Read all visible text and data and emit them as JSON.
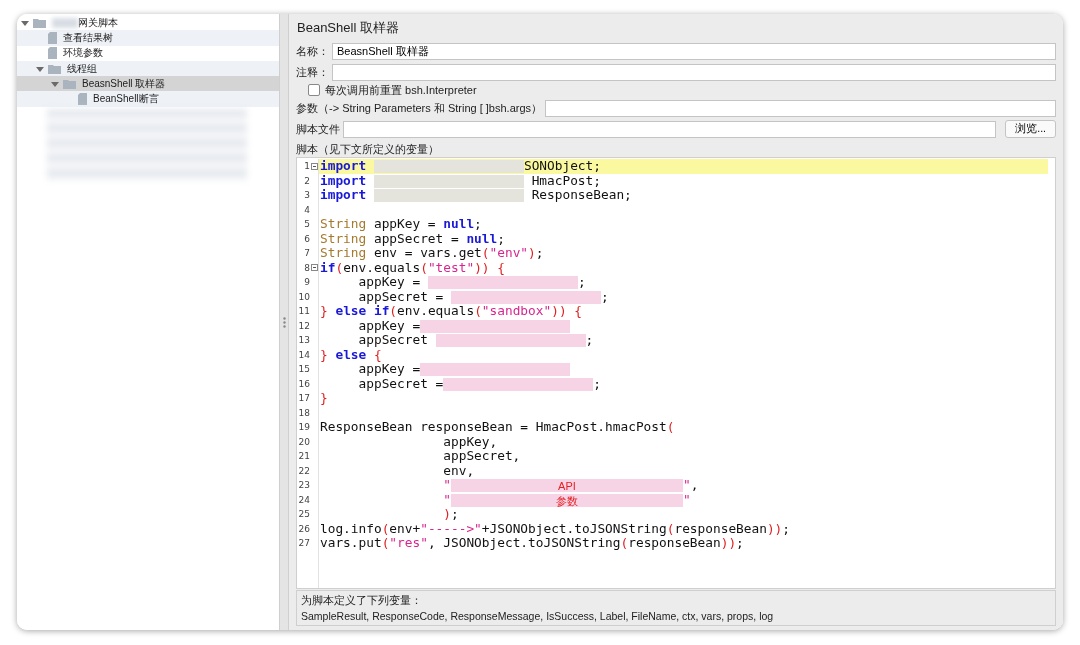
{
  "tree": [
    {
      "label": "网关脚本",
      "blurred_prefix": true,
      "kind": "folder",
      "expanded": true,
      "selected": false,
      "children": [
        {
          "label": "查看结果树",
          "kind": "file",
          "selected": false
        },
        {
          "label": "环境参数",
          "kind": "file",
          "selected": false
        },
        {
          "label": "线程组",
          "kind": "folder",
          "expanded": true,
          "selected": false,
          "children": [
            {
              "label": "BeasnShell 取样器",
              "kind": "folder",
              "expanded": true,
              "selected": true,
              "children": [
                {
                  "label": "BeanShell断言",
                  "kind": "file",
                  "selected": false
                }
              ]
            }
          ]
        }
      ]
    }
  ],
  "panel": {
    "title": "BeanShell 取样器",
    "name_label": "名称：",
    "name_value": "BeasnShell 取样器",
    "comment_label": "注释：",
    "reset_checkbox": {
      "label": "每次调用前重置 bsh.Interpreter",
      "checked": false
    },
    "params_label": "参数（-> String Parameters 和 String [ ]bsh.args）",
    "file_label": "脚本文件",
    "browse_button": "浏览...",
    "script_label": "脚本（见下文所定义的变量）",
    "code_lines": [
      {
        "number": "1",
        "current": true,
        "foldable": true,
        "segments": [
          {
            "kind": "kw",
            "text": "import "
          },
          {
            "kind": "blur",
            "color": "#e4e4dc"
          },
          {
            "kind": "plain",
            "text": "SONObject;"
          }
        ]
      },
      {
        "number": "2",
        "current": false,
        "foldable": false,
        "segments": [
          {
            "kind": "kw",
            "text": "import "
          },
          {
            "kind": "blur",
            "color": "#e4e4dc"
          },
          {
            "kind": "plain",
            "text": " HmacPost;"
          }
        ]
      },
      {
        "number": "3",
        "current": false,
        "foldable": false,
        "segments": [
          {
            "kind": "kw",
            "text": "import "
          },
          {
            "kind": "blur",
            "color": "#e4e4dc"
          },
          {
            "kind": "plain",
            "text": " ResponseBean;"
          }
        ]
      },
      {
        "number": "4",
        "current": false,
        "foldable": false
      },
      {
        "number": "5",
        "current": false,
        "foldable": false,
        "segments": [
          {
            "kind": "type",
            "text": "String"
          },
          {
            "kind": "plain",
            "text": " appKey = "
          },
          {
            "kind": "kw",
            "text": "null"
          },
          {
            "kind": "plain",
            "text": ";"
          }
        ]
      },
      {
        "number": "6",
        "current": false,
        "foldable": false,
        "segments": [
          {
            "kind": "type",
            "text": "String"
          },
          {
            "kind": "plain",
            "text": " appSecret = "
          },
          {
            "kind": "kw",
            "text": "null"
          },
          {
            "kind": "plain",
            "text": ";"
          }
        ]
      },
      {
        "number": "7",
        "current": false,
        "foldable": false,
        "segments": [
          {
            "kind": "type",
            "text": "String"
          },
          {
            "kind": "plain",
            "text": " env = vars.get"
          },
          {
            "kind": "paren",
            "text": "("
          },
          {
            "kind": "str",
            "text": "\"env\""
          },
          {
            "kind": "paren",
            "text": ")"
          },
          {
            "kind": "plain",
            "text": ";"
          }
        ]
      },
      {
        "number": "8",
        "current": false,
        "foldable": true,
        "segments": [
          {
            "kind": "kw",
            "text": "if"
          },
          {
            "kind": "paren",
            "text": "("
          },
          {
            "kind": "plain",
            "text": "env.equals"
          },
          {
            "kind": "paren",
            "text": "("
          },
          {
            "kind": "str",
            "text": "\"test\""
          },
          {
            "kind": "paren",
            "text": ")) {"
          }
        ]
      },
      {
        "number": "9",
        "current": false,
        "foldable": false,
        "segments": [
          {
            "kind": "plain",
            "text": "     appKey = "
          },
          {
            "kind": "blur",
            "color": "#f6d4e6"
          },
          {
            "kind": "plain",
            "text": ";"
          }
        ]
      },
      {
        "number": "10",
        "current": false,
        "foldable": false,
        "segments": [
          {
            "kind": "plain",
            "text": "     appSecret = "
          },
          {
            "kind": "blur",
            "color": "#f6d4e6"
          },
          {
            "kind": "plain",
            "text": ";"
          }
        ]
      },
      {
        "number": "11",
        "current": false,
        "foldable": false,
        "segments": [
          {
            "kind": "paren",
            "text": "} "
          },
          {
            "kind": "kw",
            "text": "else if"
          },
          {
            "kind": "paren",
            "text": "("
          },
          {
            "kind": "plain",
            "text": "env.equals"
          },
          {
            "kind": "paren",
            "text": "("
          },
          {
            "kind": "str",
            "text": "\"sandbox\""
          },
          {
            "kind": "paren",
            "text": ")) {"
          }
        ]
      },
      {
        "number": "12",
        "current": false,
        "foldable": false,
        "segments": [
          {
            "kind": "plain",
            "text": "     appKey ="
          },
          {
            "kind": "blur",
            "color": "#f6d4e6"
          }
        ]
      },
      {
        "number": "13",
        "current": false,
        "foldable": false,
        "segments": [
          {
            "kind": "plain",
            "text": "     appSecret "
          },
          {
            "kind": "blur",
            "color": "#f6d4e6"
          },
          {
            "kind": "plain",
            "text": ";"
          }
        ]
      },
      {
        "number": "14",
        "current": false,
        "foldable": false,
        "segments": [
          {
            "kind": "paren",
            "text": "} "
          },
          {
            "kind": "kw",
            "text": "else"
          },
          {
            "kind": "paren",
            "text": " {"
          }
        ]
      },
      {
        "number": "15",
        "current": false,
        "foldable": false,
        "segments": [
          {
            "kind": "plain",
            "text": "     appKey ="
          },
          {
            "kind": "blur",
            "color": "#f6d4e6"
          }
        ]
      },
      {
        "number": "16",
        "current": false,
        "foldable": false,
        "segments": [
          {
            "kind": "plain",
            "text": "     appSecret ="
          },
          {
            "kind": "blur",
            "color": "#f6d4e6"
          },
          {
            "kind": "plain",
            "text": ";"
          }
        ]
      },
      {
        "number": "17",
        "current": false,
        "foldable": false,
        "segments": [
          {
            "kind": "paren",
            "text": "}"
          }
        ]
      },
      {
        "number": "18",
        "current": false,
        "foldable": false
      },
      {
        "number": "19",
        "current": false,
        "foldable": false,
        "segments": [
          {
            "kind": "plain",
            "text": "ResponseBean responseBean = HmacPost.hmacPost"
          },
          {
            "kind": "paren",
            "text": "("
          }
        ]
      },
      {
        "number": "20",
        "current": false,
        "foldable": false,
        "segments": [
          {
            "kind": "plain",
            "text": "                appKey,"
          }
        ]
      },
      {
        "number": "21",
        "current": false,
        "foldable": false,
        "segments": [
          {
            "kind": "plain",
            "text": "                appSecret,"
          }
        ]
      },
      {
        "number": "22",
        "current": false,
        "foldable": false,
        "segments": [
          {
            "kind": "plain",
            "text": "                env,"
          }
        ]
      },
      {
        "number": "23",
        "current": false,
        "foldable": false,
        "segments": [
          {
            "kind": "str",
            "text": "                \""
          },
          {
            "kind": "blur",
            "color": "#f6d4e6",
            "text": "API"
          },
          {
            "kind": "str",
            "text": "\""
          },
          {
            "kind": "plain",
            "text": ","
          }
        ]
      },
      {
        "number": "24",
        "current": false,
        "foldable": false,
        "segments": [
          {
            "kind": "str",
            "text": "                \""
          },
          {
            "kind": "blur",
            "color": "#f6d4e6",
            "text": "参数"
          },
          {
            "kind": "str",
            "text": "\""
          }
        ]
      },
      {
        "number": "25",
        "current": false,
        "foldable": false,
        "segments": [
          {
            "kind": "paren",
            "text": "                )"
          },
          {
            "kind": "plain",
            "text": ";"
          }
        ]
      },
      {
        "number": "26",
        "current": false,
        "foldable": false,
        "segments": [
          {
            "kind": "plain",
            "text": "log.info"
          },
          {
            "kind": "paren",
            "text": "("
          },
          {
            "kind": "plain",
            "text": "env+"
          },
          {
            "kind": "str",
            "text": "\"----->\""
          },
          {
            "kind": "plain",
            "text": "+JSONObject.toJSONString"
          },
          {
            "kind": "paren",
            "text": "("
          },
          {
            "kind": "plain",
            "text": "responseBean"
          },
          {
            "kind": "paren",
            "text": "))"
          },
          {
            "kind": "plain",
            "text": ";"
          }
        ]
      },
      {
        "number": "27",
        "current": false,
        "foldable": false,
        "segments": [
          {
            "kind": "plain",
            "text": "vars.put"
          },
          {
            "kind": "paren",
            "text": "("
          },
          {
            "kind": "str",
            "text": "\"res\""
          },
          {
            "kind": "plain",
            "text": ", JSONObject.toJSONString"
          },
          {
            "kind": "paren",
            "text": "("
          },
          {
            "kind": "plain",
            "text": "responseBean"
          },
          {
            "kind": "paren",
            "text": "))"
          },
          {
            "kind": "plain",
            "text": ";"
          }
        ]
      }
    ],
    "vars_heading": "为脚本定义了下列变量：",
    "vars_list": "SampleResult, ResponseCode, ResponseMessage, IsSuccess, Label, FileName, ctx, vars, props, log"
  }
}
